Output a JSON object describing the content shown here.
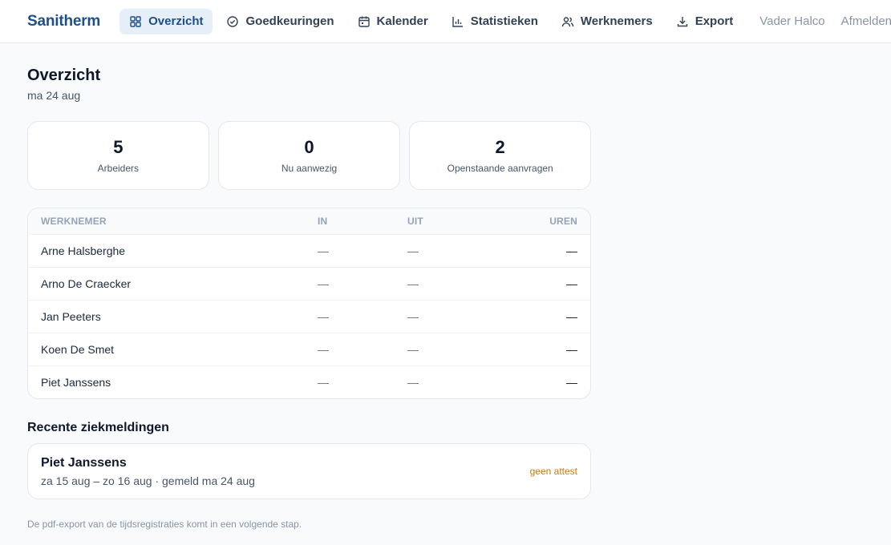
{
  "brand": "Sanitherm",
  "nav": {
    "items": [
      {
        "label": "Overzicht",
        "icon": "grid-icon"
      },
      {
        "label": "Goedkeuringen",
        "icon": "check-circle-icon"
      },
      {
        "label": "Kalender",
        "icon": "calendar-icon"
      },
      {
        "label": "Statistieken",
        "icon": "bar-chart-icon"
      },
      {
        "label": "Werknemers",
        "icon": "users-icon"
      },
      {
        "label": "Export",
        "icon": "download-icon"
      }
    ],
    "active": "Overzicht",
    "user": "Vader Halco",
    "logout": "Afmelden"
  },
  "page": {
    "title": "Overzicht",
    "date": "ma 24 aug"
  },
  "stats": [
    {
      "value": "5",
      "label": "Arbeiders"
    },
    {
      "value": "0",
      "label": "Nu aanwezig"
    },
    {
      "value": "2",
      "label": "Openstaande aanvragen"
    }
  ],
  "table": {
    "headers": {
      "name": "WERKNEMER",
      "in": "IN",
      "uit": "UIT",
      "uren": "UREN"
    },
    "rows": [
      {
        "name": "Arne Halsberghe",
        "in": "—",
        "uit": "—",
        "uren": "—"
      },
      {
        "name": "Arno De Craecker",
        "in": "—",
        "uit": "—",
        "uren": "—"
      },
      {
        "name": "Jan Peeters",
        "in": "—",
        "uit": "—",
        "uren": "—"
      },
      {
        "name": "Koen De Smet",
        "in": "—",
        "uit": "—",
        "uren": "—"
      },
      {
        "name": "Piet Janssens",
        "in": "—",
        "uit": "—",
        "uren": "—"
      }
    ]
  },
  "sick": {
    "title": "Recente ziekmeldingen",
    "items": [
      {
        "name": "Piet Janssens",
        "detail": "za 15 aug – zo 16 aug · gemeld ma 24 aug",
        "badge": "geen attest"
      }
    ]
  },
  "footnote": "De pdf-export van de tijdsregistraties komt in een volgende stap.",
  "colors": {
    "brand": "#1e4e8c",
    "active_bg": "#e6eef8",
    "badge_warning": "#c27a0e"
  }
}
